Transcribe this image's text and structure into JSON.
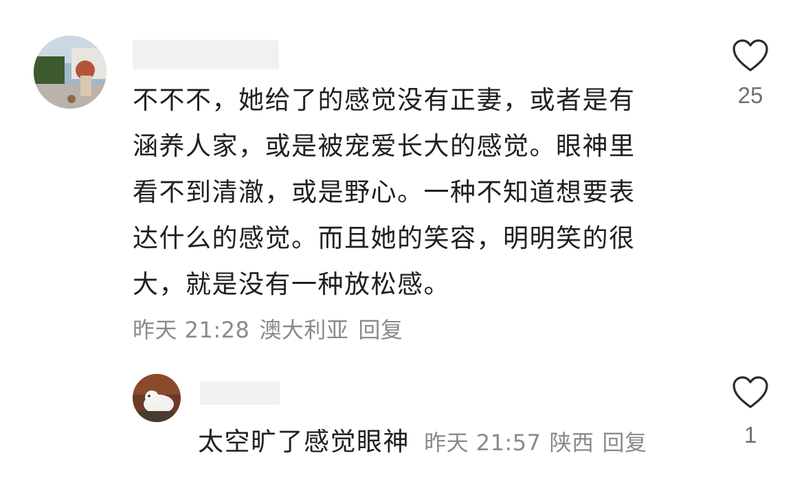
{
  "comment": {
    "text": "不不不，她给了的感觉没有正妻，或者是有\n涵养人家，或是被宠爱长大的感觉。眼神里\n看不到清澈，或是野心。一种不知道想要表\n达什么的感觉。而且她的笑容，明明笑的很\n大，就是没有一种放松感。",
    "time": "昨天 21:28",
    "location": "澳大利亚",
    "reply_label": "回复",
    "like_count": "25",
    "like_icon": "heart-outline-icon"
  },
  "reply": {
    "text": "太空旷了感觉眼神",
    "time": "昨天 21:57",
    "location": "陕西",
    "reply_label": "回复",
    "like_count": "1",
    "like_icon": "heart-outline-icon"
  },
  "colors": {
    "text_primary": "#202020",
    "text_secondary": "#8a8a8a",
    "like_count": "#6f6f6f",
    "name_placeholder": "#f1f1f1"
  }
}
